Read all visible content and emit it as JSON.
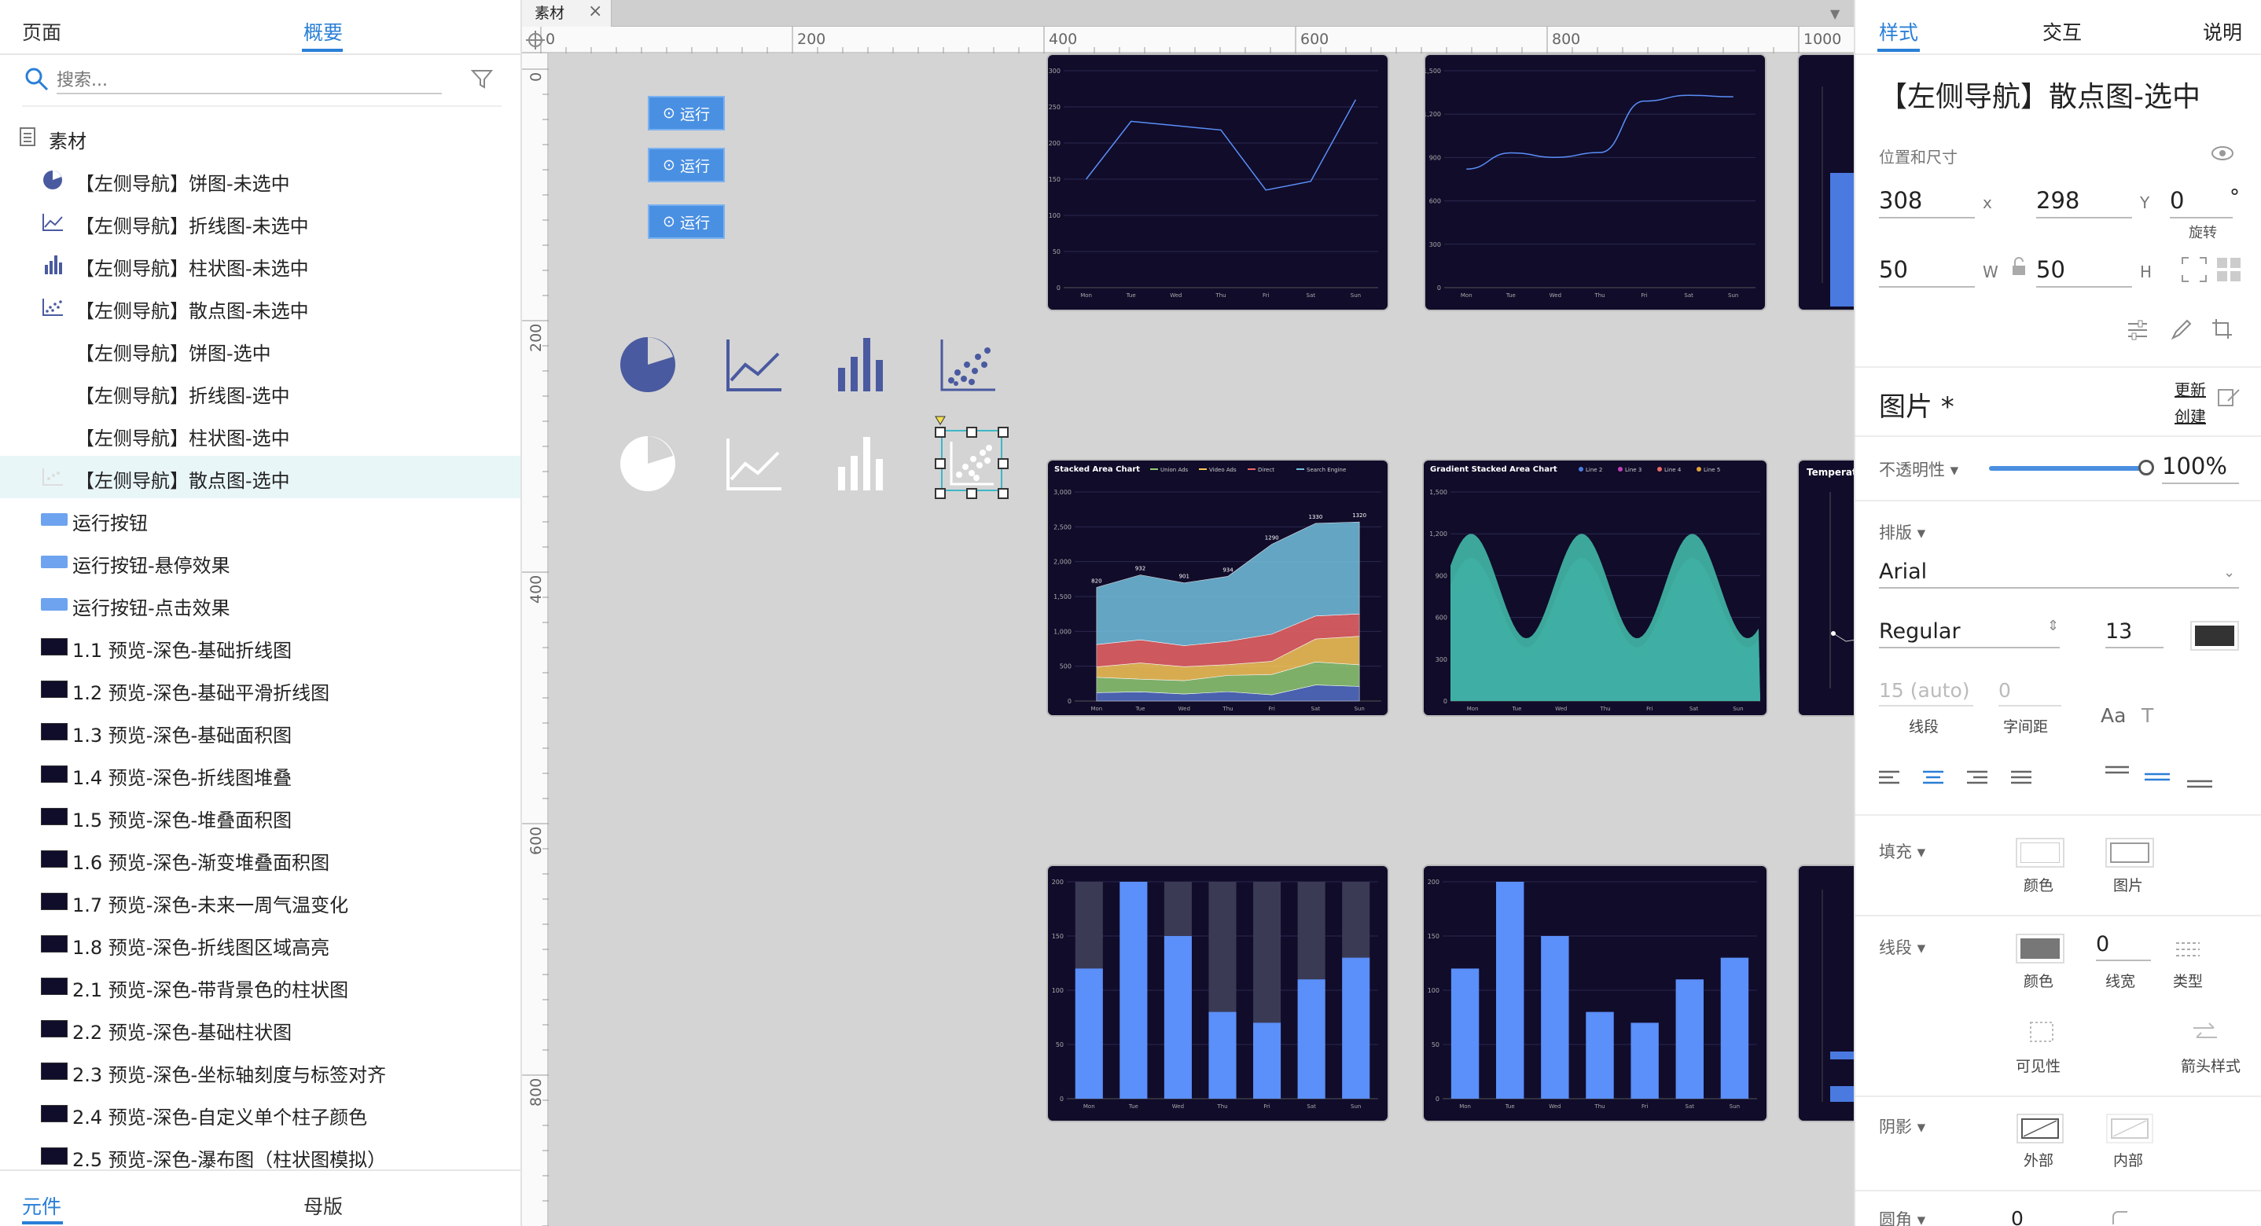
{
  "left_panel": {
    "tabs": [
      "页面",
      "概要"
    ],
    "active_tab": "概要",
    "search_placeholder": "搜索...",
    "root_label": "素材",
    "items": [
      {
        "label": "【左侧导航】饼图-未选中",
        "icon": "pie-icon"
      },
      {
        "label": "【左侧导航】折线图-未选中",
        "icon": "line-icon"
      },
      {
        "label": "【左侧导航】柱状图-未选中",
        "icon": "bar-icon"
      },
      {
        "label": "【左侧导航】散点图-未选中",
        "icon": "scatter-icon"
      },
      {
        "label": "【左侧导航】饼图-选中",
        "icon": "none"
      },
      {
        "label": "【左侧导航】折线图-选中",
        "icon": "none"
      },
      {
        "label": "【左侧导航】柱状图-选中",
        "icon": "none"
      },
      {
        "label": "【左侧导航】散点图-选中",
        "icon": "scatter-faint-icon",
        "selected": true
      },
      {
        "label": "运行按钮",
        "icon": "button-icon"
      },
      {
        "label": "运行按钮-悬停效果",
        "icon": "button-icon"
      },
      {
        "label": "运行按钮-点击效果",
        "icon": "button-icon"
      },
      {
        "label": "1.1 预览-深色-基础折线图",
        "icon": "thumb-icon"
      },
      {
        "label": "1.2 预览-深色-基础平滑折线图",
        "icon": "thumb-icon"
      },
      {
        "label": "1.3 预览-深色-基础面积图",
        "icon": "thumb-icon"
      },
      {
        "label": "1.4 预览-深色-折线图堆叠",
        "icon": "thumb-icon"
      },
      {
        "label": "1.5 预览-深色-堆叠面积图",
        "icon": "thumb-icon"
      },
      {
        "label": "1.6 预览-深色-渐变堆叠面积图",
        "icon": "thumb-icon"
      },
      {
        "label": "1.7 预览-深色-未来一周气温变化",
        "icon": "thumb-icon"
      },
      {
        "label": "1.8 预览-深色-折线图区域高亮",
        "icon": "thumb-icon"
      },
      {
        "label": "2.1 预览-深色-带背景色的柱状图",
        "icon": "thumb-icon"
      },
      {
        "label": "2.2 预览-深色-基础柱状图",
        "icon": "thumb-icon"
      },
      {
        "label": "2.3 预览-深色-坐标轴刻度与标签对齐",
        "icon": "thumb-icon"
      },
      {
        "label": "2.4 预览-深色-自定义单个柱子颜色",
        "icon": "thumb-icon"
      },
      {
        "label": "2.5 预览-深色-瀑布图（柱状图模拟）",
        "icon": "thumb-icon"
      }
    ],
    "bottom_tabs": [
      "元件",
      "母版"
    ]
  },
  "canvas": {
    "tab_label": "素材",
    "ruler_h": [
      "0",
      "200",
      "400",
      "600",
      "800",
      "1000"
    ],
    "ruler_v": [
      "0",
      "200",
      "400",
      "600",
      "800"
    ],
    "run_buttons": [
      "运行",
      "运行",
      "运行"
    ],
    "chart_titles": {
      "stacked": "Stacked Area Chart",
      "gradient": "Gradient Stacked Area Chart",
      "temperature": "Temperature"
    },
    "days": [
      "Mon",
      "Tue",
      "Wed",
      "Thu",
      "Fri",
      "Sat",
      "Sun"
    ],
    "stacked_legend": [
      "Union Ads",
      "Video Ads",
      "Direct",
      "Search Engine"
    ],
    "gradient_legend": [
      "Line 2",
      "Line 3",
      "Line 4",
      "Line 5"
    ]
  },
  "chart_data": [
    {
      "type": "line",
      "x": [
        "Mon",
        "Tue",
        "Wed",
        "Thu",
        "Fri",
        "Sat",
        "Sun"
      ],
      "values": [
        150,
        230,
        224,
        218,
        135,
        147,
        260
      ],
      "ylim": [
        0,
        300
      ],
      "yticks": [
        "0",
        "50",
        "100",
        "150",
        "200",
        "250",
        "300"
      ]
    },
    {
      "type": "line",
      "x": [
        "Mon",
        "Tue",
        "Wed",
        "Thu",
        "Fri",
        "Sat",
        "Sun"
      ],
      "values": [
        820,
        932,
        901,
        934,
        1290,
        1330,
        1320
      ],
      "ylim": [
        0,
        1500
      ],
      "yticks": [
        "0",
        "300",
        "600",
        "900",
        "1,200",
        "1,500"
      ]
    },
    {
      "type": "area",
      "title": "Stacked Area Chart",
      "x": [
        "Mon",
        "Tue",
        "Wed",
        "Thu",
        "Fri",
        "Sat",
        "Sun"
      ],
      "ylim": [
        0,
        3000
      ],
      "yticks": [
        "0",
        "500",
        "1,000",
        "1,500",
        "2,000",
        "2,500",
        "3,000"
      ],
      "data_labels": [
        "820",
        "932",
        "901",
        "934",
        "1290",
        "1330",
        "1320"
      ]
    },
    {
      "type": "area",
      "title": "Gradient Stacked Area Chart",
      "x": [
        "Mon",
        "Tue",
        "Wed",
        "Thu",
        "Fri",
        "Sat",
        "Sun"
      ],
      "ylim": [
        0,
        1500
      ],
      "yticks": [
        "0",
        "300",
        "600",
        "900",
        "1,200",
        "1,500"
      ]
    },
    {
      "type": "bar",
      "categories": [
        "Mon",
        "Tue",
        "Wed",
        "Thu",
        "Fri",
        "Sat",
        "Sun"
      ],
      "values": [
        120,
        200,
        150,
        80,
        70,
        110,
        130
      ],
      "background": 200,
      "ylim": [
        0,
        200
      ],
      "yticks": [
        "0",
        "50",
        "100",
        "150",
        "200"
      ]
    },
    {
      "type": "bar",
      "categories": [
        "Mon",
        "Tue",
        "Wed",
        "Thu",
        "Fri",
        "Sat",
        "Sun"
      ],
      "values": [
        120,
        200,
        150,
        80,
        70,
        110,
        130
      ],
      "ylim": [
        0,
        200
      ],
      "yticks": [
        "0",
        "50",
        "100",
        "150",
        "200"
      ]
    }
  ],
  "right_panel": {
    "tabs": [
      "样式",
      "交互",
      "说明"
    ],
    "title": "【左侧导航】散点图-选中",
    "pos_size_label": "位置和尺寸",
    "x_value": "308",
    "x_label": "x",
    "y_value": "298",
    "y_label": "Y",
    "rotation_value": "0",
    "rotation_unit": "°",
    "rotation_label": "旋转",
    "w_value": "50",
    "w_label": "W",
    "h_value": "50",
    "h_label": "H",
    "image_title": "图片 *",
    "update_link": "更新",
    "create_link": "创建",
    "opacity_label": "不透明性",
    "opacity_value": "100%",
    "opacity_fraction": 1.0,
    "layout_label": "排版",
    "font_family": "Arial",
    "font_weight": "Regular",
    "font_size": "13",
    "line_height": "15 (auto)",
    "line_height_label": "线段",
    "letter_spacing": "0",
    "letter_spacing_label": "字间距",
    "fill_label": "填充",
    "fill_color_label": "颜色",
    "fill_image_label": "图片",
    "stroke_label": "线段",
    "stroke_color_label": "颜色",
    "stroke_width": "0",
    "stroke_width_label": "线宽",
    "stroke_type_label": "类型",
    "visibility_label": "可见性",
    "arrow_label": "箭头样式",
    "shadow_label": "阴影",
    "shadow_outer_label": "外部",
    "shadow_inner_label": "内部",
    "corner_label": "圆角",
    "corner_value": "0",
    "accent_color": "#2a7fd6",
    "text_color_swatch": "#333333"
  }
}
